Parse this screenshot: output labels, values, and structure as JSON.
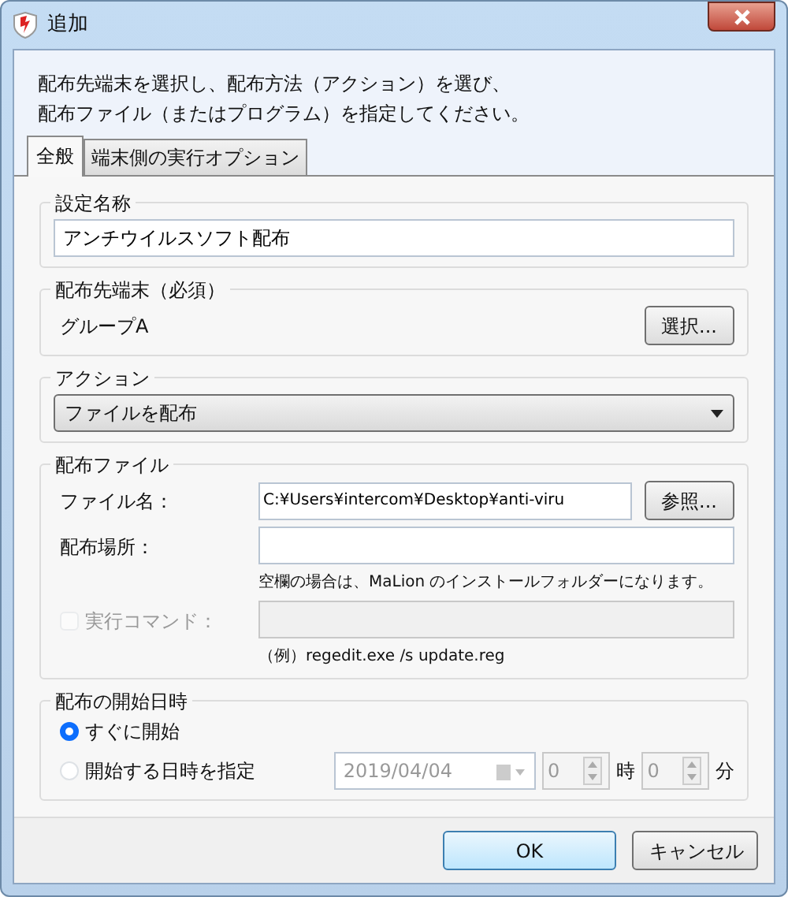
{
  "window": {
    "title": "追加"
  },
  "instructions": [
    "配布先端末を選択し、配布方法（アクション）を選び、",
    "配布ファイル（またはプログラム）を指定してください。"
  ],
  "tabs": [
    {
      "label": "全般",
      "selected": true
    },
    {
      "label": "端末側の実行オプション",
      "selected": false
    }
  ],
  "setting_name": {
    "label": "設定名称",
    "value": "アンチウイルスソフト配布"
  },
  "target": {
    "label": "配布先端末（必須）",
    "value": "グループA",
    "button": "選択..."
  },
  "action": {
    "label": "アクション",
    "value": "ファイルを配布"
  },
  "file": {
    "label": "配布ファイル",
    "filename_label": "ファイル名：",
    "filename_value": "C:¥Users¥intercom¥Desktop¥anti-viru",
    "browse_button": "参照...",
    "location_label": "配布場所：",
    "location_hint": "空欄の場合は、MaLion のインストールフォルダーになります。",
    "command_label": "実行コマンド：",
    "command_checked": false,
    "command_disabled": true,
    "command_example": "（例）regedit.exe /s update.reg"
  },
  "start": {
    "label": "配布の開始日時",
    "options": [
      {
        "label": "すぐに開始",
        "selected": true
      },
      {
        "label": "開始する日時を指定",
        "selected": false
      }
    ],
    "date": "2019/04/04",
    "hour": "0",
    "hour_unit": "時",
    "minute": "0",
    "minute_unit": "分",
    "disabled": true
  },
  "buttons": [
    {
      "label": "OK",
      "default": true
    },
    {
      "label": "キャンセル",
      "default": false
    }
  ]
}
